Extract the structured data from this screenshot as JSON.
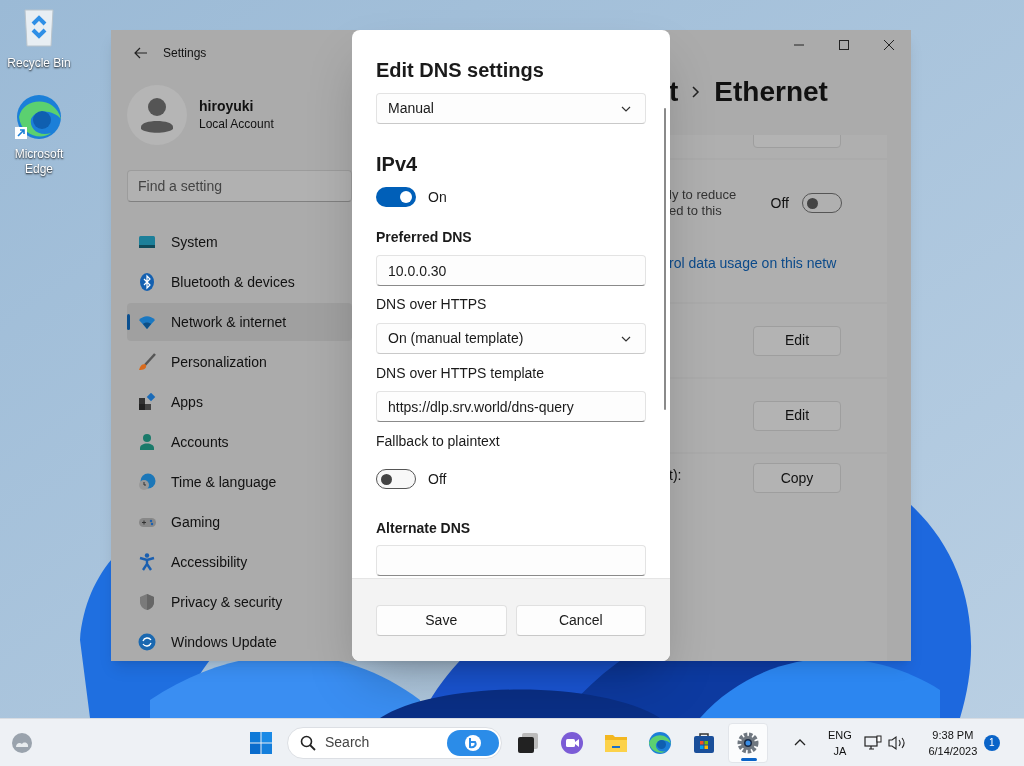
{
  "desktop": {
    "icons": [
      {
        "kind": "recycle_bin",
        "label": "Recycle Bin"
      },
      {
        "kind": "edge",
        "label": "Microsoft Edge"
      }
    ]
  },
  "settings": {
    "title": "Settings",
    "account": {
      "name": "hiroyuki",
      "type": "Local Account"
    },
    "search": {
      "placeholder": "Find a setting"
    },
    "nav": [
      {
        "label": "System",
        "kind": "system",
        "selected": false
      },
      {
        "label": "Bluetooth & devices",
        "kind": "bluetooth",
        "selected": false
      },
      {
        "label": "Network & internet",
        "kind": "network",
        "selected": true
      },
      {
        "label": "Personalization",
        "kind": "personalization",
        "selected": false
      },
      {
        "label": "Apps",
        "kind": "apps",
        "selected": false
      },
      {
        "label": "Accounts",
        "kind": "accounts",
        "selected": false
      },
      {
        "label": "Time & language",
        "kind": "time",
        "selected": false
      },
      {
        "label": "Gaming",
        "kind": "gaming",
        "selected": false
      },
      {
        "label": "Accessibility",
        "kind": "accessibility",
        "selected": false
      },
      {
        "label": "Privacy & security",
        "kind": "privacy",
        "selected": false
      },
      {
        "label": "Windows Update",
        "kind": "update",
        "selected": false
      }
    ],
    "breadcrumb": {
      "parent": "t",
      "current": "Ethernet"
    },
    "content": [
      {
        "kind": "clipped"
      },
      {
        "kind": "toggle",
        "lines": [
          "ly to reduce",
          "ed to this"
        ],
        "state": "Off",
        "on": false,
        "link": "rol data usage on this netw"
      },
      {
        "kind": "button",
        "button": "Edit"
      },
      {
        "kind": "button",
        "button": "Edit"
      },
      {
        "kind": "button",
        "label": "t):",
        "button": "Copy"
      }
    ]
  },
  "dialog": {
    "title": "Edit DNS settings",
    "items": [
      {
        "kind": "dropdown",
        "value": "Manual"
      },
      {
        "kind": "heading",
        "text": "IPv4"
      },
      {
        "kind": "toggle",
        "on": true,
        "text": "On"
      },
      {
        "kind": "subheading",
        "text": "Preferred DNS"
      },
      {
        "kind": "input",
        "value": "10.0.0.30"
      },
      {
        "kind": "label",
        "text": "DNS over HTTPS"
      },
      {
        "kind": "dropdown",
        "value": "On (manual template)"
      },
      {
        "kind": "label",
        "text": "DNS over HTTPS template"
      },
      {
        "kind": "input",
        "value": "https://dlp.srv.world/dns-query"
      },
      {
        "kind": "label",
        "text": "Fallback to plaintext"
      },
      {
        "kind": "toggle",
        "on": false,
        "text": "Off"
      },
      {
        "kind": "subheading",
        "text": "Alternate DNS"
      },
      {
        "kind": "input"
      }
    ],
    "buttons": [
      "Save",
      "Cancel"
    ]
  },
  "taskbar": {
    "search": {
      "placeholder": "Search"
    },
    "apps": [
      {
        "kind": "taskview",
        "selected": false
      },
      {
        "kind": "meet",
        "selected": false
      },
      {
        "kind": "explorer",
        "selected": false
      },
      {
        "kind": "edge",
        "selected": false
      },
      {
        "kind": "store",
        "selected": false
      },
      {
        "kind": "settings",
        "selected": true
      }
    ],
    "language": [
      "ENG",
      "JA"
    ],
    "time": "9:38 PM",
    "date": "6/14/2023",
    "notifications": "1"
  }
}
